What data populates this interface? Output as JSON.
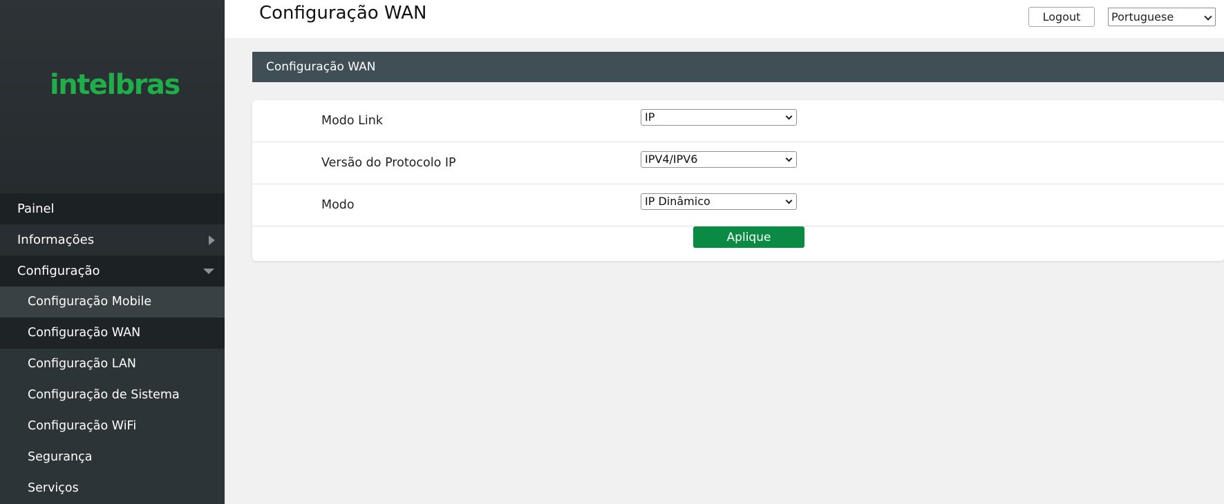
{
  "brand": {
    "logo_text": "intelbras",
    "logo_color": "#1fae4a"
  },
  "header": {
    "title": "Configuração WAN",
    "logout_label": "Logout",
    "language": {
      "selected": "Portuguese"
    }
  },
  "sidebar": {
    "items": [
      {
        "label": "Painel"
      },
      {
        "label": "Informações"
      },
      {
        "label": "Configuração"
      }
    ],
    "sub_items": [
      {
        "label": "Configuração Mobile"
      },
      {
        "label": "Configuração WAN"
      },
      {
        "label": "Configuração LAN"
      },
      {
        "label": "Configuração de Sistema"
      },
      {
        "label": "Configuração WiFi"
      },
      {
        "label": "Segurança"
      },
      {
        "label": "Serviços"
      }
    ]
  },
  "main": {
    "section_title": "Configuração WAN",
    "fields": [
      {
        "label": "Modo Link",
        "value": "IP"
      },
      {
        "label": "Versão do Protocolo IP",
        "value": "IPV4/IPV6"
      },
      {
        "label": "Modo",
        "value": "IP Dinâmico"
      }
    ],
    "apply_label": "Aplique"
  },
  "colors": {
    "accent_green": "#0a8a42",
    "section_bar": "#3f4f55",
    "sidebar_bg": "#2d3336"
  }
}
